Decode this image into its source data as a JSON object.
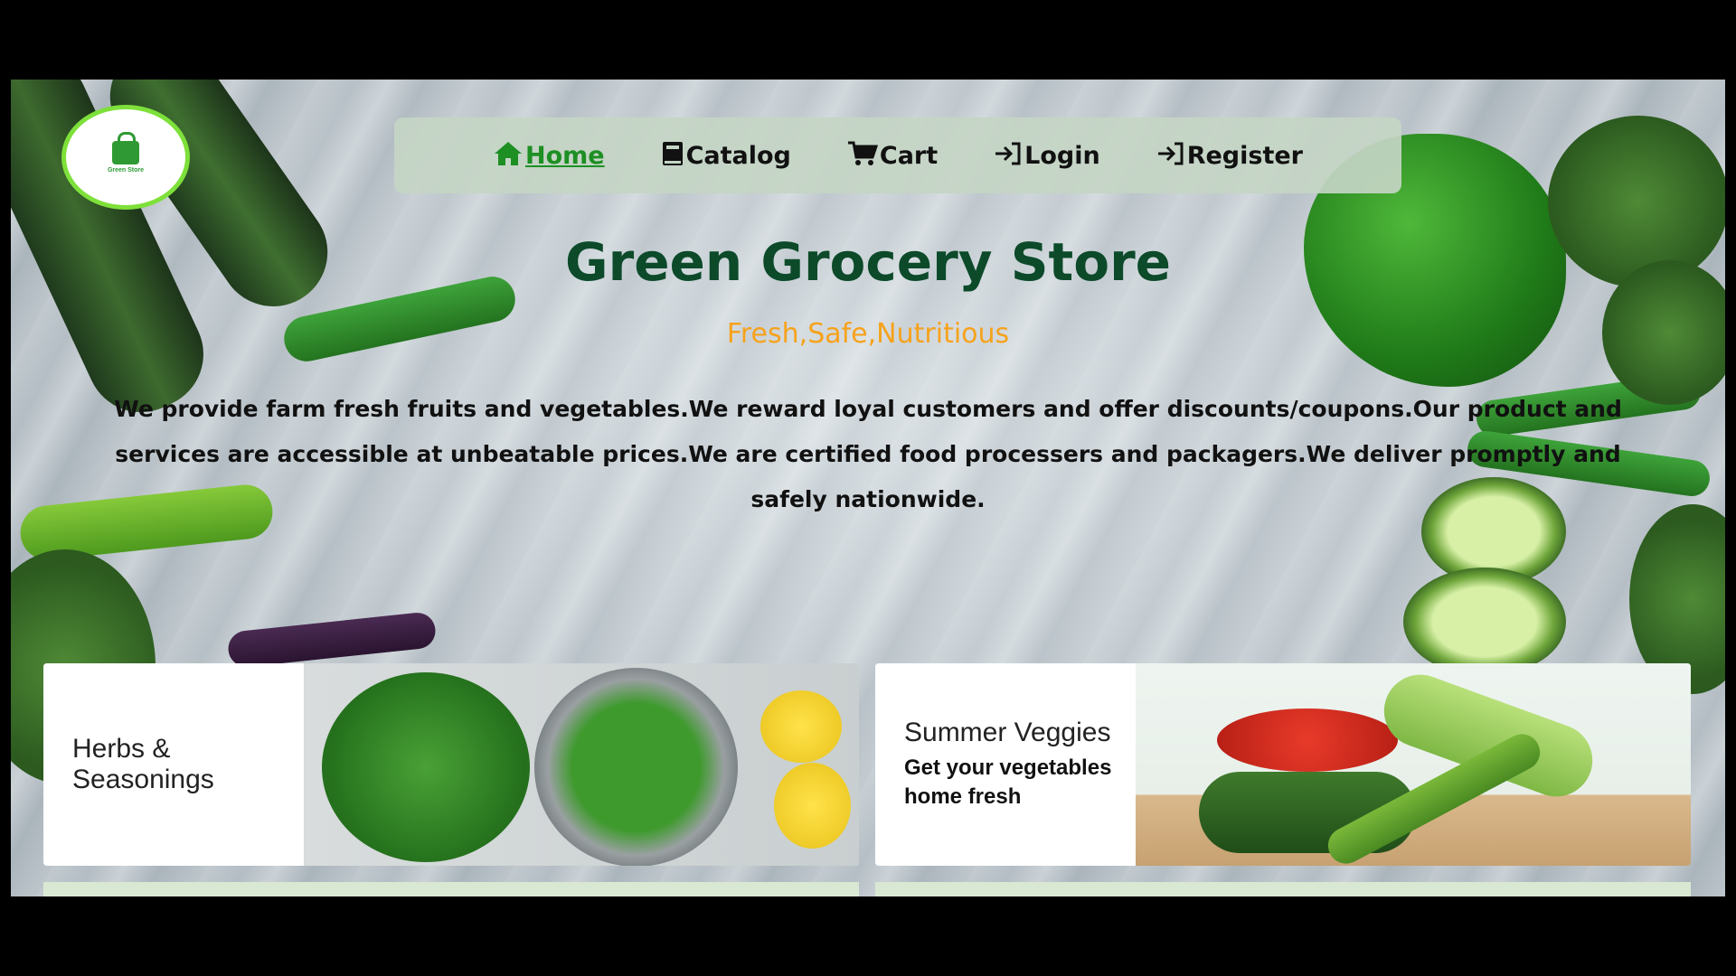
{
  "brand": {
    "logo_text": "Green Store"
  },
  "nav": {
    "items": [
      {
        "label": "Home",
        "icon": "home-icon",
        "active": true
      },
      {
        "label": "Catalog",
        "icon": "book-icon",
        "active": false
      },
      {
        "label": "Cart",
        "icon": "cart-icon",
        "active": false
      },
      {
        "label": "Login",
        "icon": "login-icon",
        "active": false
      },
      {
        "label": "Register",
        "icon": "register-icon",
        "active": false
      }
    ]
  },
  "hero": {
    "title": "Green Grocery Store",
    "tagline": "Fresh,Safe,Nutritious",
    "description": "We provide farm fresh fruits and vegetables.We reward loyal customers and offer discounts/coupons.Our product and services are accessible at unbeatable prices.We are certified food processers and packagers.We deliver promptly and safely nationwide."
  },
  "cards": [
    {
      "title": "Herbs & Seasonings",
      "subtitle": ""
    },
    {
      "title": "Summer Veggies",
      "subtitle": "Get your vegetables home fresh"
    }
  ],
  "colors": {
    "title": "#0c4a2a",
    "tagline": "#f6a21c",
    "nav_active": "#1d8f23",
    "nav_bg": "#c4d5c4",
    "logo_border": "#7ee03a"
  }
}
